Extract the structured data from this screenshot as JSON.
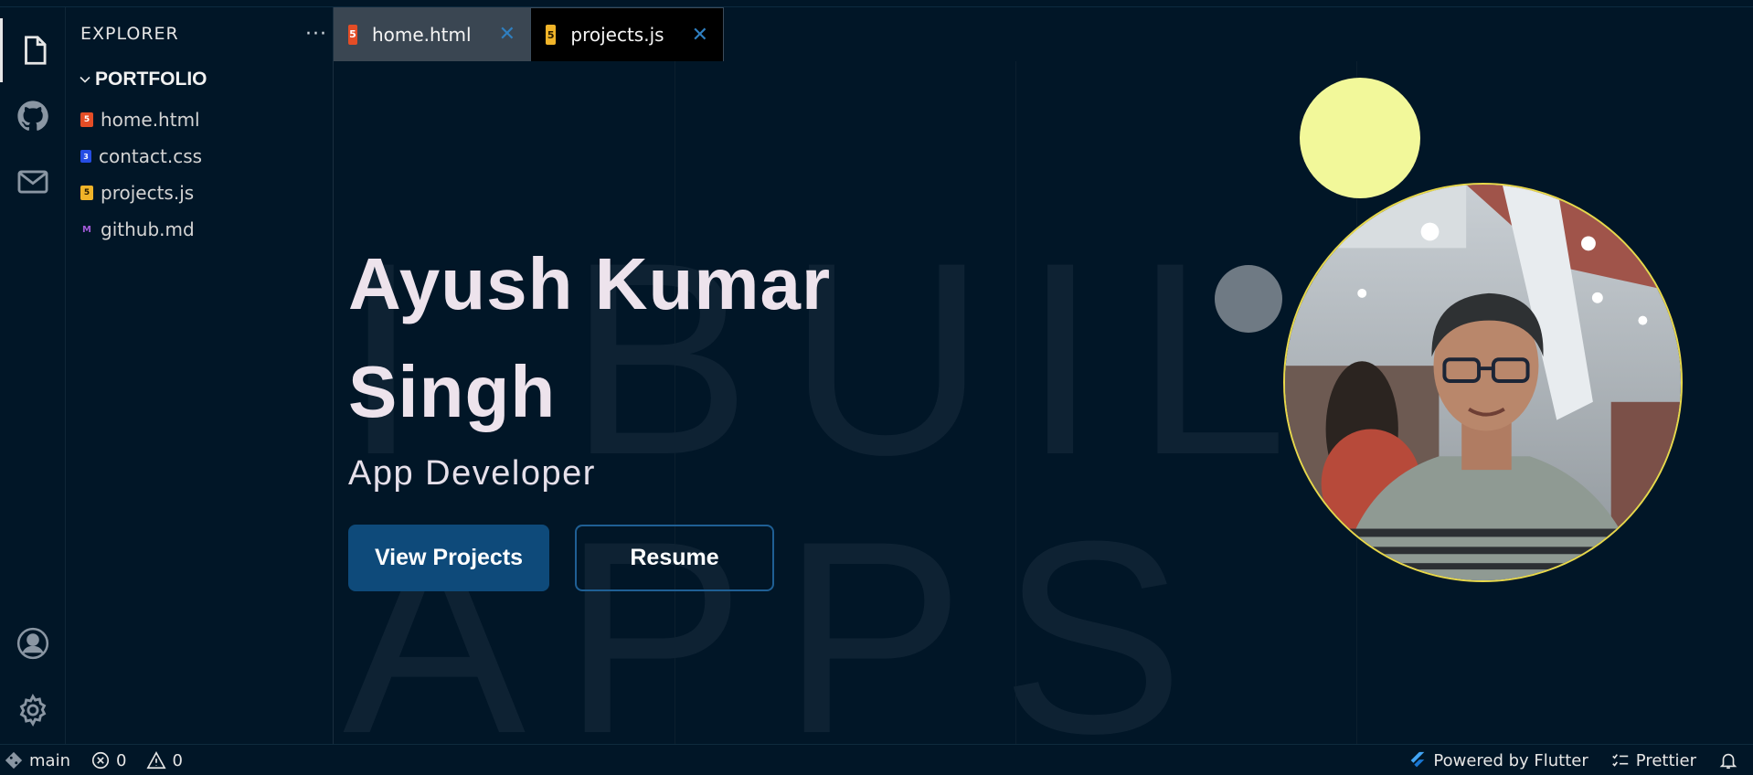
{
  "explorer": {
    "title": "EXPLORER",
    "more": "···",
    "folder": "PORTFOLIO",
    "files": [
      {
        "name": "home.html",
        "icon": "html-file-icon"
      },
      {
        "name": "contact.css",
        "icon": "css-file-icon"
      },
      {
        "name": "projects.js",
        "icon": "js-file-icon"
      },
      {
        "name": "github.md",
        "icon": "markdown-file-icon"
      }
    ]
  },
  "tabs": [
    {
      "label": "home.html",
      "icon": "html-file-icon",
      "close": "✕",
      "active": false
    },
    {
      "label": "projects.js",
      "icon": "js-file-icon",
      "close": "✕",
      "active": true
    }
  ],
  "hero": {
    "bg_line1": "I BUILD",
    "bg_line2": "APPS",
    "name_line1": "Ayush Kumar",
    "name_line2": "Singh",
    "role": "App Developer",
    "primary_button": "View Projects",
    "secondary_button": "Resume"
  },
  "statusbar": {
    "branch": "main",
    "errors": "0",
    "warnings": "0",
    "powered_by": "Powered by Flutter",
    "prettier": "Prettier"
  },
  "colors": {
    "background": "#011627",
    "primary_button": "#0e4a7a",
    "accent_yellow": "#f2f89a",
    "tab_close": "#2f7fc0"
  }
}
